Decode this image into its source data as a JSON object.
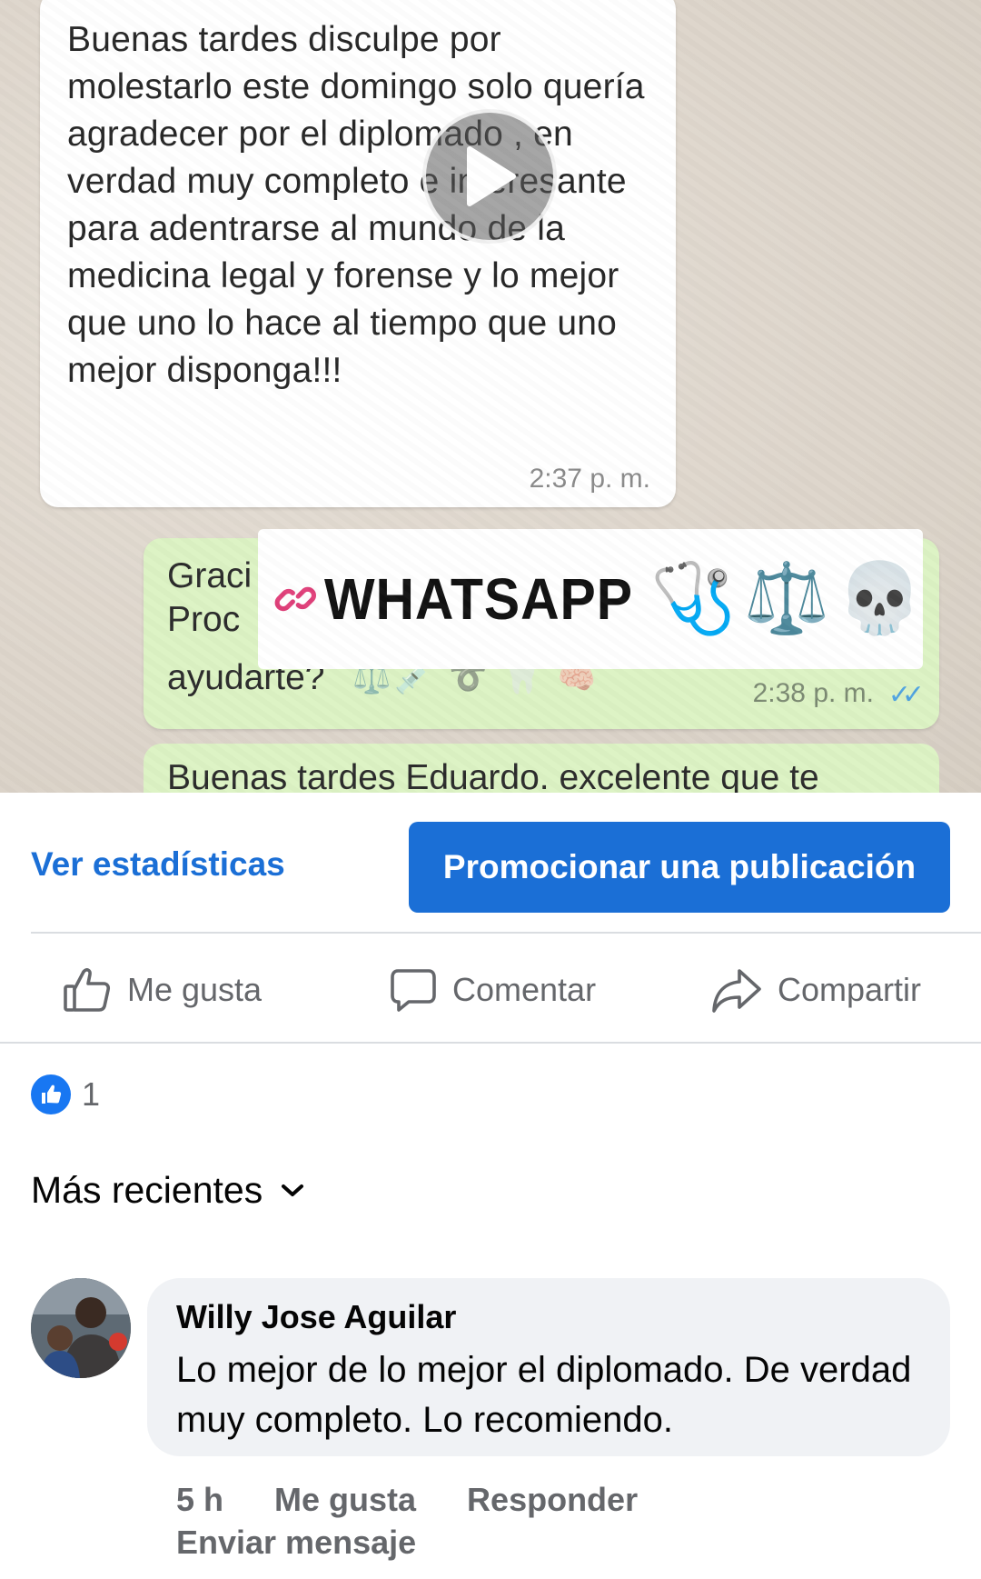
{
  "media": {
    "incoming_message": "Buenas tardes disculpe por molestarlo este domingo solo quería agradecer por el diplomado , en verdad muy completo e interesante para adentrarse al mundo de la medicina legal y forense y lo mejor que uno lo hace al tiempo que uno mejor disponga!!!",
    "incoming_time": "2:37 p. m.",
    "outgoing_line1": "Graci",
    "outgoing_line2": "Proc",
    "outgoing_line3": "ayudarte?",
    "outgoing_emojis": "⚖️💉 ➰ 🦷 🧠",
    "outgoing_time": "2:38 p. m.",
    "outgoing_ticks": "✓✓",
    "next_message": "Buenas tardes Eduardo. excelente que te",
    "overlay_title": "WHATSAPP",
    "overlay_emojis": [
      "🩺",
      "⚖️",
      "💀"
    ]
  },
  "actions": {
    "stats_label": "Ver estadísticas",
    "promote_label": "Promocionar una publicación"
  },
  "reaction_bar": {
    "like_label": "Me gusta",
    "comment_label": "Comentar",
    "share_label": "Compartir"
  },
  "reactions": {
    "count": "1"
  },
  "sort": {
    "label": "Más recientes"
  },
  "comment": {
    "author": "Willy Jose Aguilar",
    "text": "Lo mejor de lo mejor el diplomado.  De verdad muy completo.  Lo recomiendo.",
    "time": "5 h",
    "like_label": "Me gusta",
    "reply_label": "Responder",
    "send_message_label": "Enviar mensaje"
  },
  "colors": {
    "accent": "#1b6fd6",
    "like_badge": "#1877f2",
    "secondary_text": "#65676b",
    "comment_bg": "#f0f2f5",
    "wa_outgoing": "#dcf3c4"
  },
  "icons": [
    "play-icon",
    "link-icon",
    "thumbs-up-icon",
    "comment-icon",
    "share-icon",
    "like-badge-icon",
    "chevron-down-icon"
  ]
}
